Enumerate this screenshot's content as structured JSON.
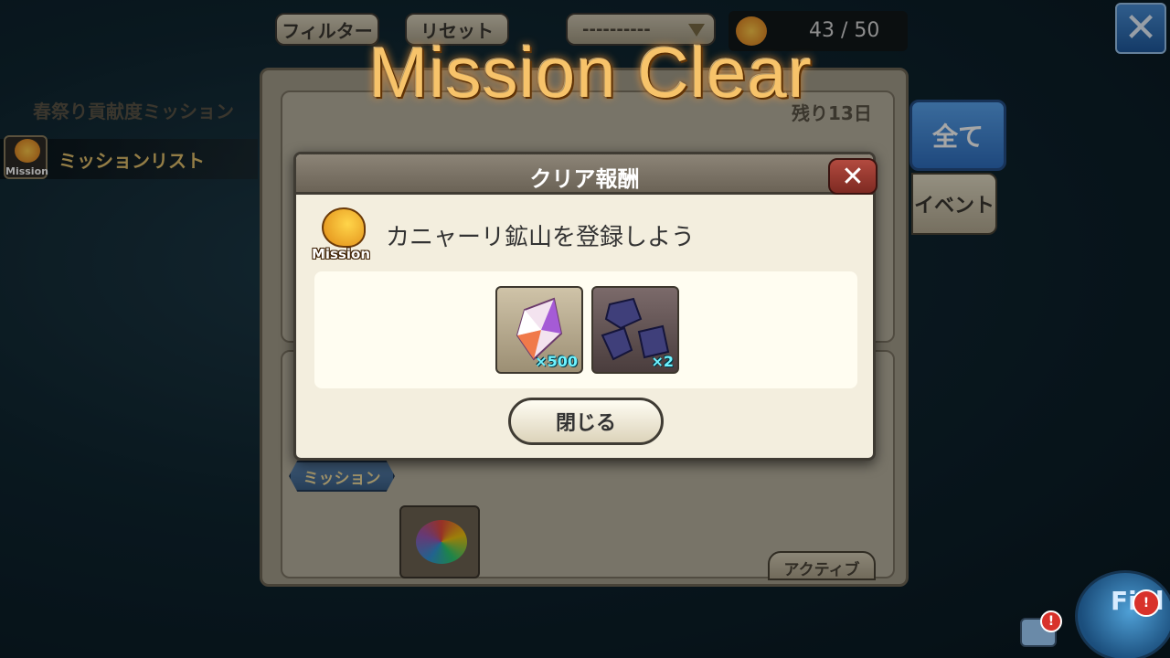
{
  "toolbar": {
    "filter_label": "フィルター",
    "reset_label": "リセット",
    "dropdown_value": "----------",
    "counter_value": "43 / 50"
  },
  "side": {
    "mission_icon_label": "Mission",
    "mission_list_label": "ミッションリスト"
  },
  "tabs": {
    "all_label": "全て",
    "event_label": "イベント"
  },
  "panel": {
    "card_title": "春祭り貢献度ミッション",
    "remaining": "残り13日",
    "mission_ribbon": "ミッション",
    "active_label": "アクティブ"
  },
  "overlay": {
    "mission_clear": "Mission Clear"
  },
  "modal": {
    "title": "クリア報酬",
    "logo_text": "Mission",
    "mission_name": "カニャーリ鉱山を登録しよう",
    "rewards": [
      {
        "qty": "×500"
      },
      {
        "qty": "×2"
      }
    ],
    "close_label": "閉じる"
  },
  "field": {
    "label": "Fi d",
    "badge": "!"
  },
  "colors": {
    "accent_blue": "#2f6fc0",
    "gold_title": "#f7c36a",
    "close_red": "#b24a3f"
  }
}
